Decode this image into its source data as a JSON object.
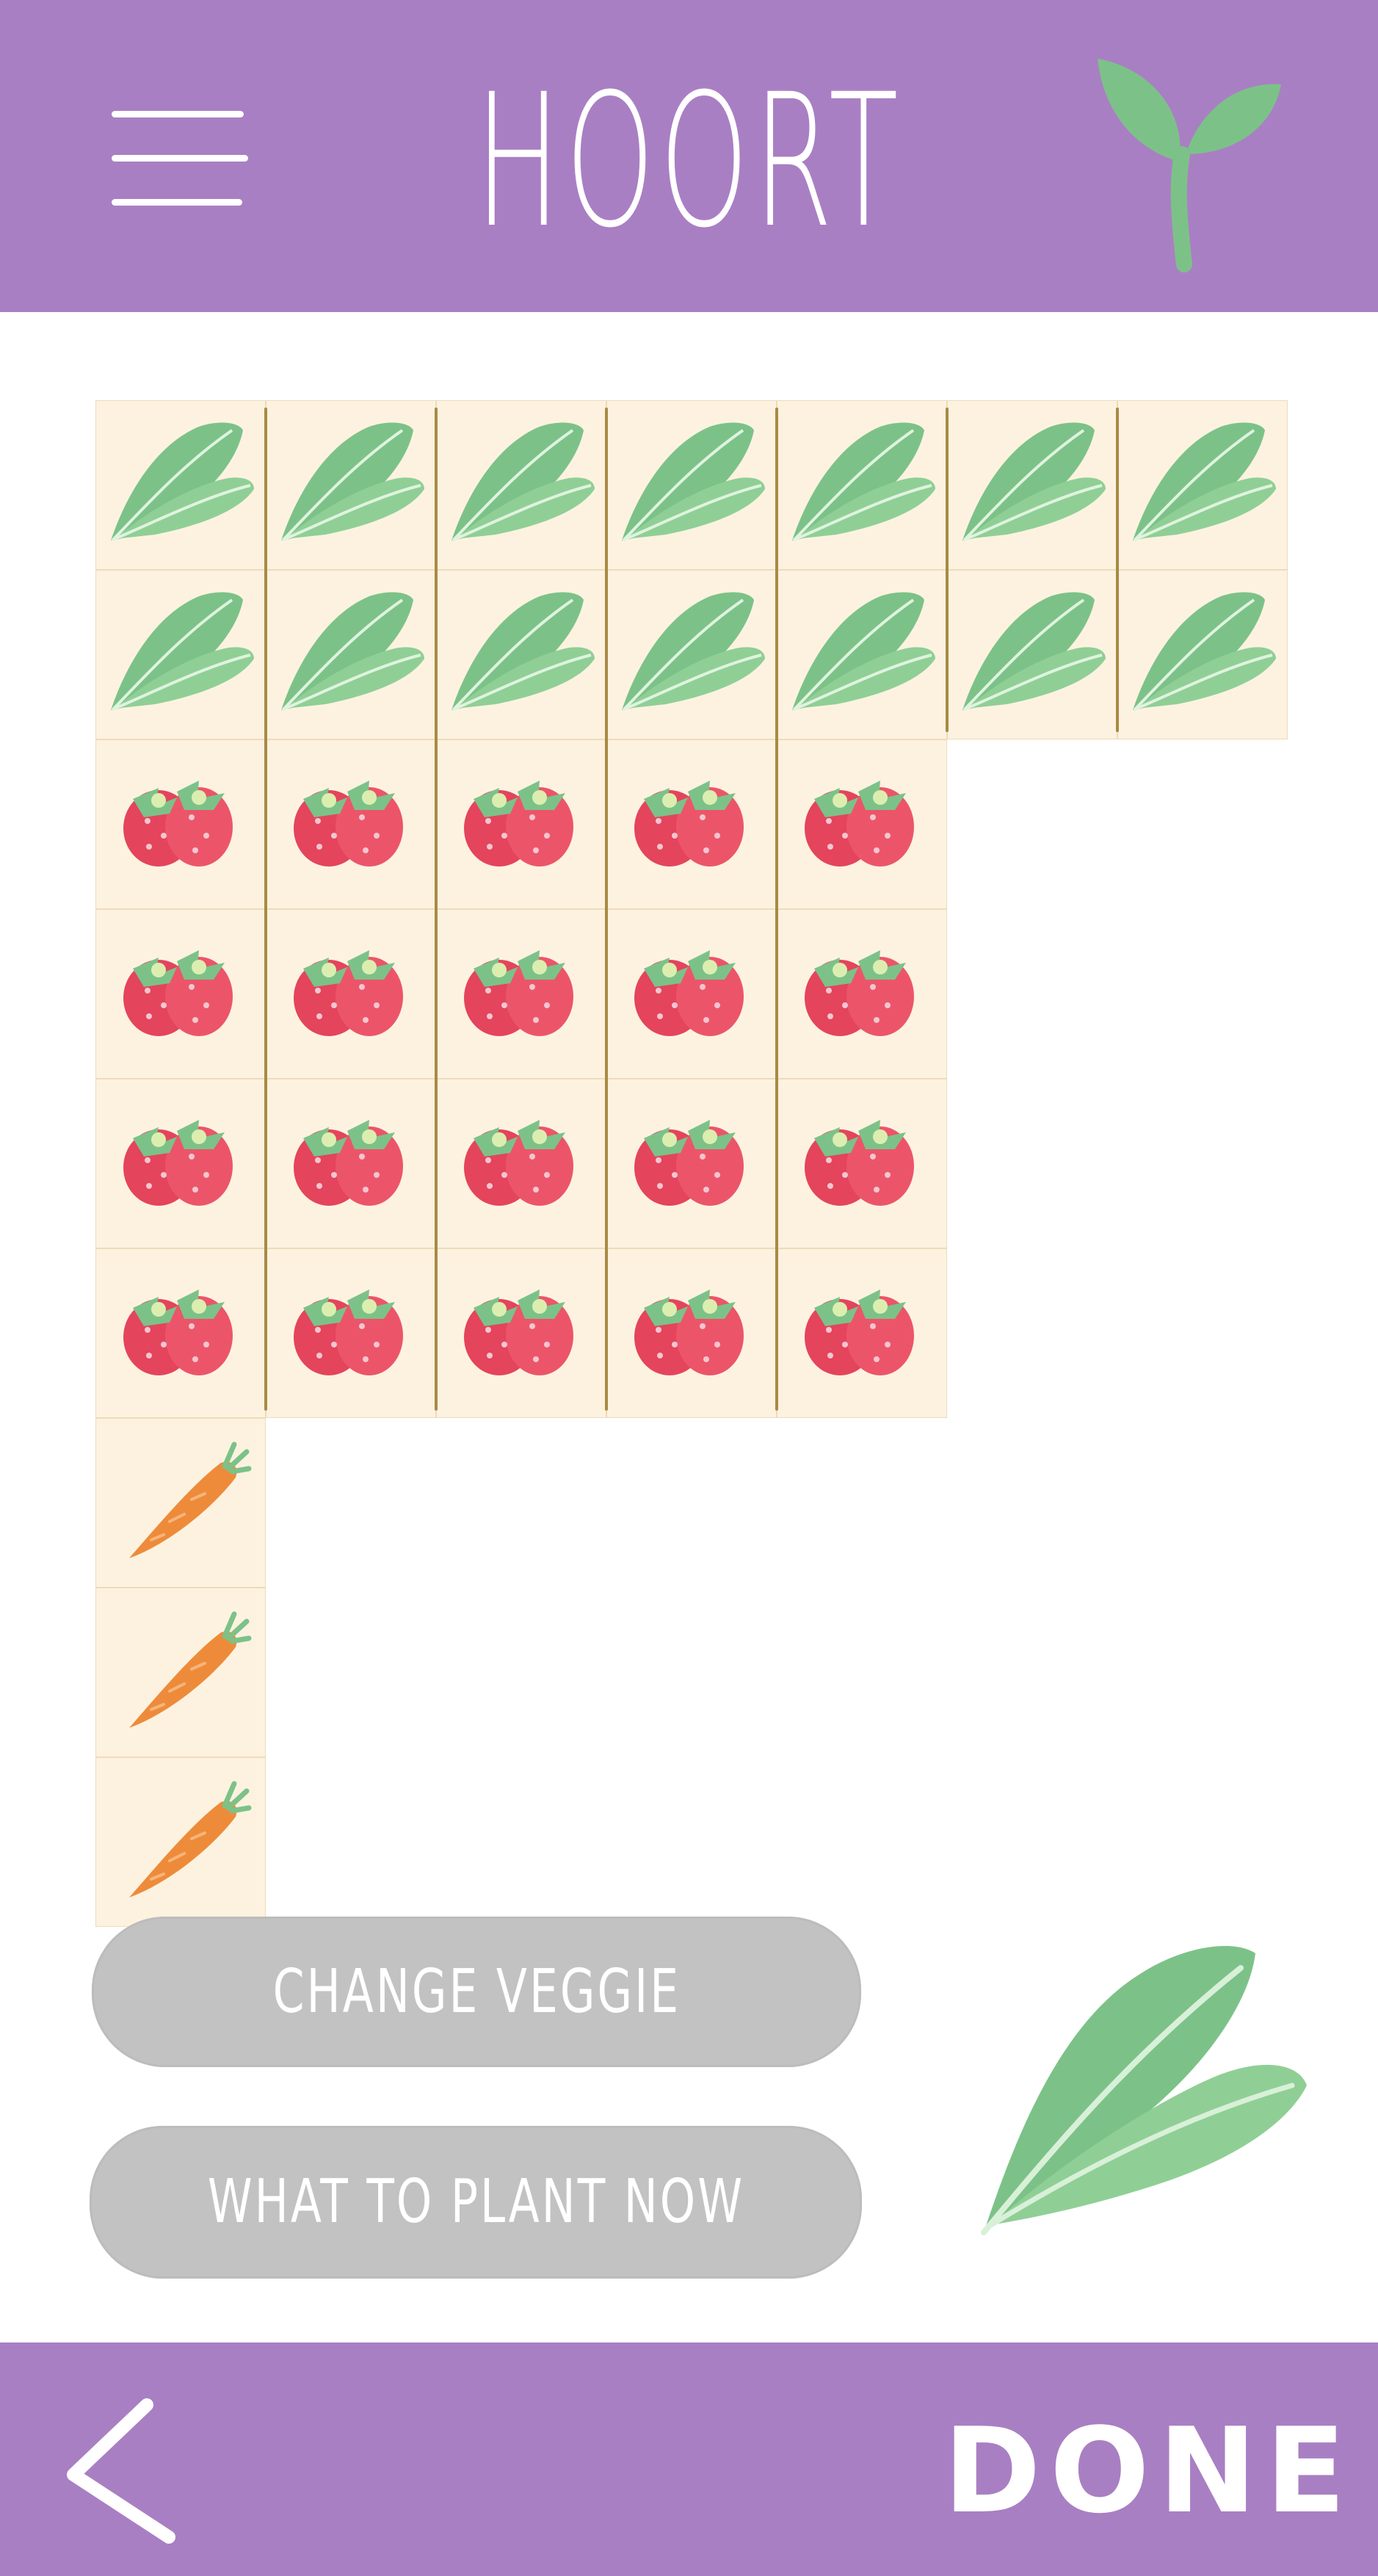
{
  "header": {
    "title": "HOORT",
    "menu_icon": "hamburger-menu-icon",
    "logo_icon": "sprout-icon"
  },
  "colors": {
    "bar": "#a97fc3",
    "tile": "#fdf2e0",
    "divider": "#a98a45",
    "button": "#c2c2c2",
    "leaf": "#7cc288",
    "strawberry": "#e4445c",
    "carrot": "#ee8b3a"
  },
  "garden": {
    "rows": [
      [
        "spinach",
        "spinach",
        "spinach",
        "spinach",
        "spinach",
        "spinach",
        "spinach"
      ],
      [
        "spinach",
        "spinach",
        "spinach",
        "spinach",
        "spinach",
        "spinach",
        "spinach"
      ],
      [
        "strawberry",
        "strawberry",
        "strawberry",
        "strawberry",
        "strawberry"
      ],
      [
        "strawberry",
        "strawberry",
        "strawberry",
        "strawberry",
        "strawberry"
      ],
      [
        "strawberry",
        "strawberry",
        "strawberry",
        "strawberry",
        "strawberry"
      ],
      [
        "strawberry",
        "strawberry",
        "strawberry",
        "strawberry",
        "strawberry"
      ],
      [
        "carrot"
      ],
      [
        "carrot"
      ],
      [
        "carrot"
      ]
    ]
  },
  "actions": {
    "change_veggie": "CHANGE VEGGIE",
    "what_to_plant": "WHAT TO PLANT NOW"
  },
  "selected_veggie": "spinach",
  "footer": {
    "back_icon": "chevron-left-icon",
    "done_label": "DONE"
  }
}
